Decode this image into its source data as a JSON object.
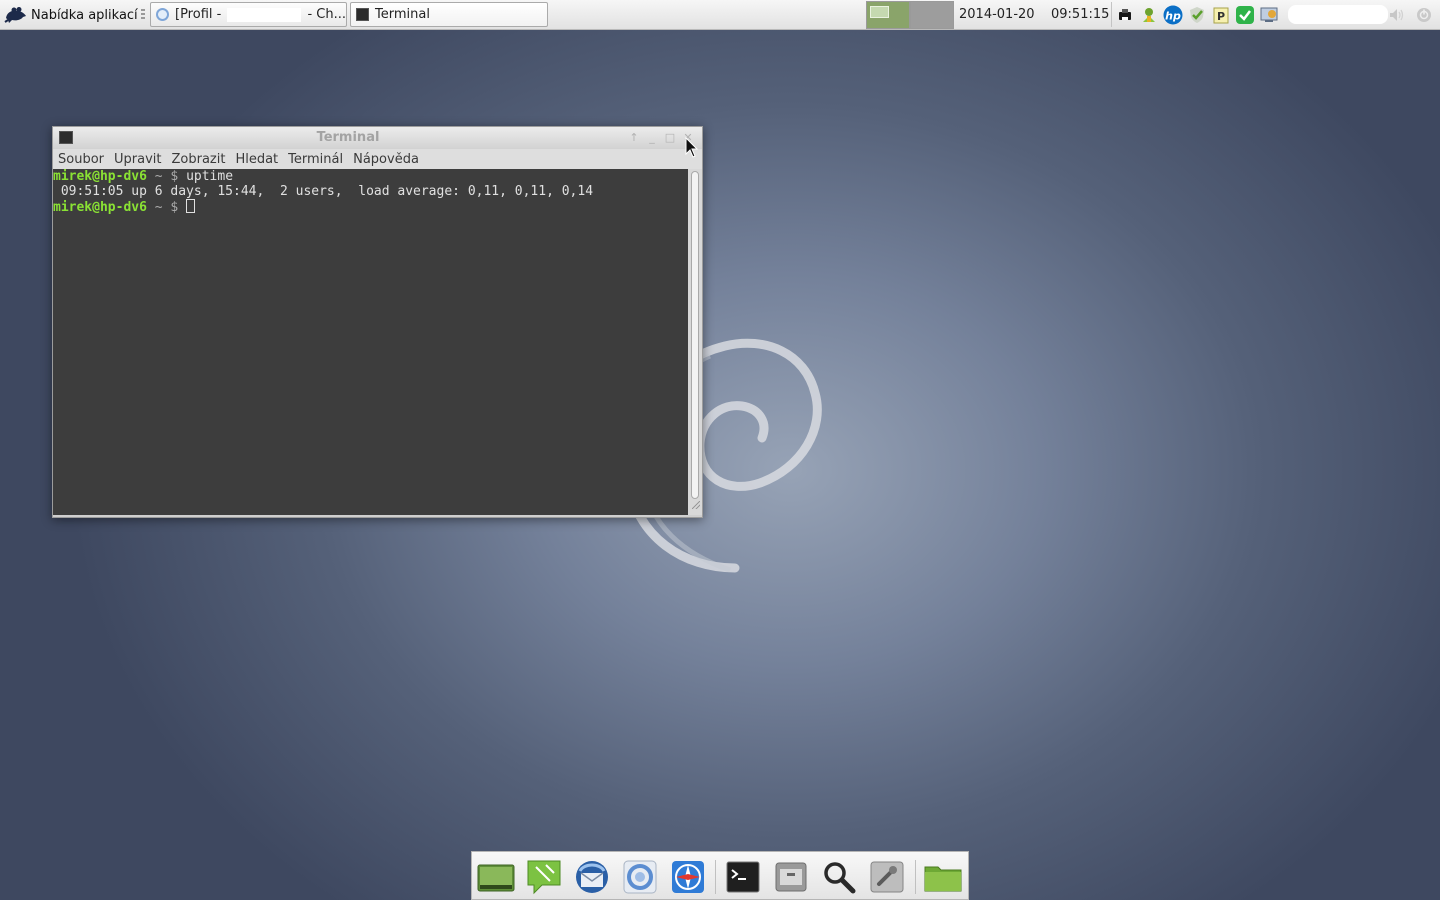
{
  "top_panel": {
    "app_menu_label": "Nabídka aplikací",
    "tasks": [
      {
        "label_start": "[Profil - ",
        "label_end": " - Ch..."
      },
      {
        "label": "Terminal"
      }
    ],
    "date": "2014-01-20",
    "time": "09:51:15",
    "tray_icons": [
      "printer-icon",
      "updates-icon",
      "hp-icon",
      "shield-check-icon",
      "p-clipboard-icon",
      "green-check-icon",
      "network-icon"
    ]
  },
  "terminal_window": {
    "title": "Terminal",
    "menu": [
      "Soubor",
      "Upravit",
      "Zobrazit",
      "Hledat",
      "Terminál",
      "Nápověda"
    ],
    "lines": {
      "l1_user": "mirek@hp-dv6",
      "l1_path": " ~ $ ",
      "l1_cmd": "uptime",
      "l2_output": " 09:51:05 up 6 days, 15:44,  2 users,  load average: 0,11, 0,11, 0,14",
      "l3_user": "mirek@hp-dv6",
      "l3_path": " ~ $ "
    }
  },
  "dock": {
    "items": [
      "desktop-icon",
      "notes-icon",
      "thunderbird-icon",
      "chromium-icon",
      "compass-icon",
      "terminal-icon",
      "archive-icon",
      "search-icon",
      "settings-icon",
      "folder-icon"
    ]
  },
  "colors": {
    "prompt_user": "#8ae234",
    "workspace_active": "#8aa46a",
    "terminal_bg": "#3d3d3d"
  }
}
